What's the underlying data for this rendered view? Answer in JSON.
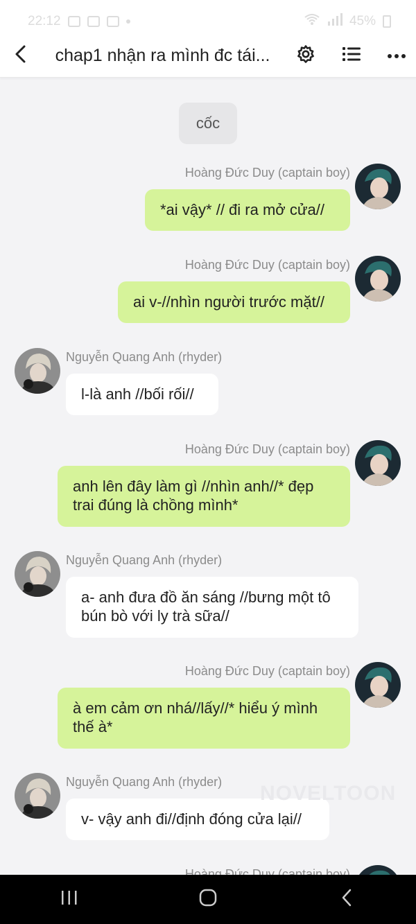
{
  "status_bar": {
    "time": "22:12",
    "battery": "45%"
  },
  "header": {
    "title": "chap1 nhận ra mình đc tái...",
    "icons": [
      "back-icon",
      "gear-icon",
      "list-icon",
      "more-icon"
    ]
  },
  "chat": {
    "narration": "cốc",
    "messages": [
      {
        "side": "right",
        "sender": "Hoàng Đức Duy (captain boy)",
        "text": "*ai vậy* // đi ra mở cửa//"
      },
      {
        "side": "right",
        "sender": "Hoàng Đức Duy (captain boy)",
        "text": "ai v-//nhìn người trước mặt//"
      },
      {
        "side": "left",
        "sender": "Nguyễn Quang Anh (rhyder)",
        "text": "l-là anh //bối rối//"
      },
      {
        "side": "right",
        "sender": "Hoàng Đức Duy (captain boy)",
        "text": "anh lên đây làm gì //nhìn anh//* đẹp trai đúng là chồng mình*"
      },
      {
        "side": "left",
        "sender": "Nguyễn Quang Anh (rhyder)",
        "text": "a- anh đưa đồ ăn sáng //bưng một tô bún bò với ly trà sữa//"
      },
      {
        "side": "right",
        "sender": "Hoàng Đức Duy (captain boy)",
        "text": "à em cảm ơn nhá//lấy//* hiểu ý mình thế à*"
      },
      {
        "side": "left",
        "sender": "Nguyễn Quang Anh (rhyder)",
        "text": "v- vậy anh đi//định đóng cửa lại//"
      },
      {
        "side": "right",
        "sender": "Hoàng Đức Duy (captain boy)",
        "text": ""
      }
    ],
    "watermark": "NOVELTOON"
  },
  "colors": {
    "right_bubble": "#d6f39a",
    "left_bubble": "#ffffff",
    "background": "#f3f3f5"
  }
}
